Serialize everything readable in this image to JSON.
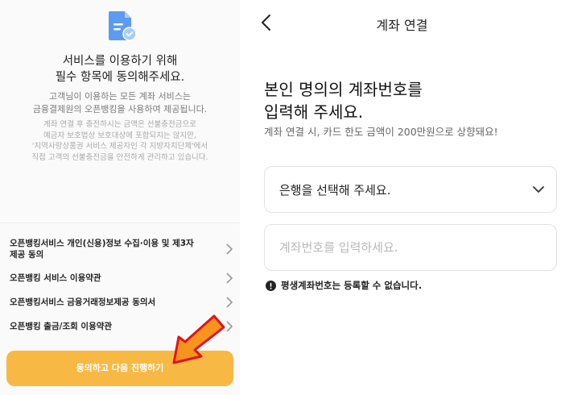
{
  "consent": {
    "title_line1": "서비스를 이용하기 위해",
    "title_line2": "필수 항목에 동의해주세요.",
    "desc_line1": "고객님이 이용하는 모든 계좌 서비스는",
    "desc_line2": "금융결제원의 오픈뱅킹을 사용하여 제공됩니다.",
    "note_lines": [
      "계좌 연결 후 충전하시는 금액은 선불충전금으로",
      "예금자 보호법상 보호대상에 포함되지는 않지만,",
      "'지역사랑상품권 서비스 제공자인 각 지방자치단체'에서",
      "직접 고객의 선불충전금을 안전하게 관리하고 있습니다."
    ],
    "terms": [
      {
        "line1": "오픈뱅킹서비스 개인(신용)정보 수집·이용 및 제3자",
        "line2": "제공 동의"
      },
      {
        "line1": "오픈뱅킹 서비스 이용약관"
      },
      {
        "line1": "오픈뱅킹서비스 금융거래정보제공 동의서"
      },
      {
        "line1": "오픈뱅킹 출금/조회 이용약관"
      }
    ],
    "agree_button": "동의하고 다음 진행하기",
    "accent_color": "#f7b944",
    "annotation_arrow_color": "#f7941d"
  },
  "account": {
    "header_title": "계좌 연결",
    "heading_line1": "본인 명의의 계좌번호를",
    "heading_line2": "입력해 주세요.",
    "subtext": "계좌 연결 시, 카드 한도 금액이 200만원으로 상향돼요!",
    "bank_select_placeholder": "은행을 선택해 주세요.",
    "account_input_placeholder": "계좌번호를 입력하세요.",
    "notice": "평생계좌번호는 등록할 수 없습니다."
  }
}
